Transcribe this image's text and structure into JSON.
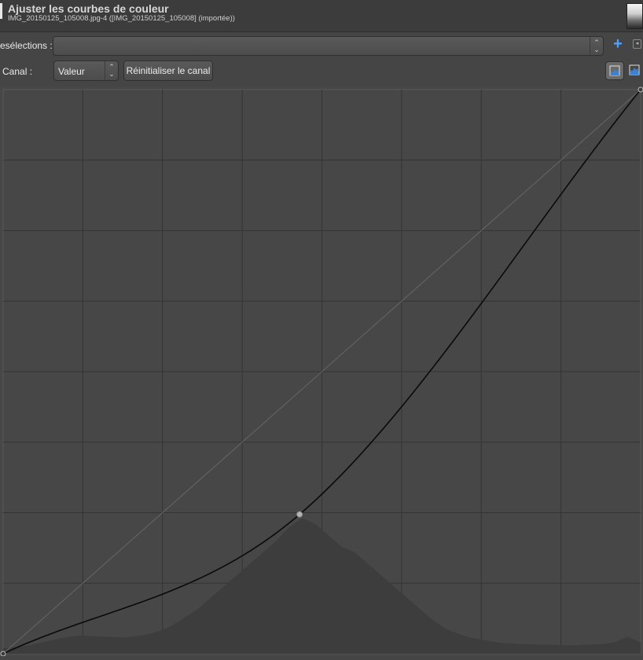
{
  "header": {
    "title": "Ajuster les courbes de couleur",
    "subtitle": "IMG_20150125_105008.jpg-4 ([IMG_20150125_105008] (importée))"
  },
  "presets": {
    "label": "esélections :",
    "value": ""
  },
  "channel": {
    "label": "Canal :",
    "value": "Valeur",
    "reset_label": "Réinitialiser le canal"
  },
  "icons": {
    "add": "plus-icon",
    "menu": "panel-menu-icon",
    "linear_histogram": "linear-histogram-icon",
    "log_histogram": "logarithmic-histogram-icon",
    "accent": "#4ea3ff"
  },
  "chart_data": {
    "type": "line",
    "xlim": [
      0,
      1
    ],
    "ylim": [
      0,
      1
    ],
    "grid": true,
    "grid_divisions": 8,
    "control_points": [
      {
        "x": 0.0,
        "y": 0.0
      },
      {
        "x": 0.465,
        "y": 0.247
      },
      {
        "x": 1.0,
        "y": 1.0
      }
    ],
    "reference_line": [
      [
        0,
        0
      ],
      [
        1,
        1
      ]
    ],
    "histogram": [
      0.01,
      0.012,
      0.015,
      0.02,
      0.025,
      0.03,
      0.032,
      0.031,
      0.03,
      0.029,
      0.03,
      0.034,
      0.04,
      0.05,
      0.065,
      0.08,
      0.1,
      0.12,
      0.14,
      0.16,
      0.18,
      0.2,
      0.225,
      0.24,
      0.23,
      0.21,
      0.19,
      0.18,
      0.16,
      0.14,
      0.12,
      0.1,
      0.08,
      0.06,
      0.045,
      0.035,
      0.028,
      0.024,
      0.02,
      0.018,
      0.017,
      0.016,
      0.016,
      0.015,
      0.015,
      0.016,
      0.017,
      0.02,
      0.03,
      0.02
    ],
    "curve_color": "#0a0a0a",
    "reference_color": "#666666",
    "histogram_color": "#3d3d3d",
    "point_color": "#b5b5b5"
  }
}
